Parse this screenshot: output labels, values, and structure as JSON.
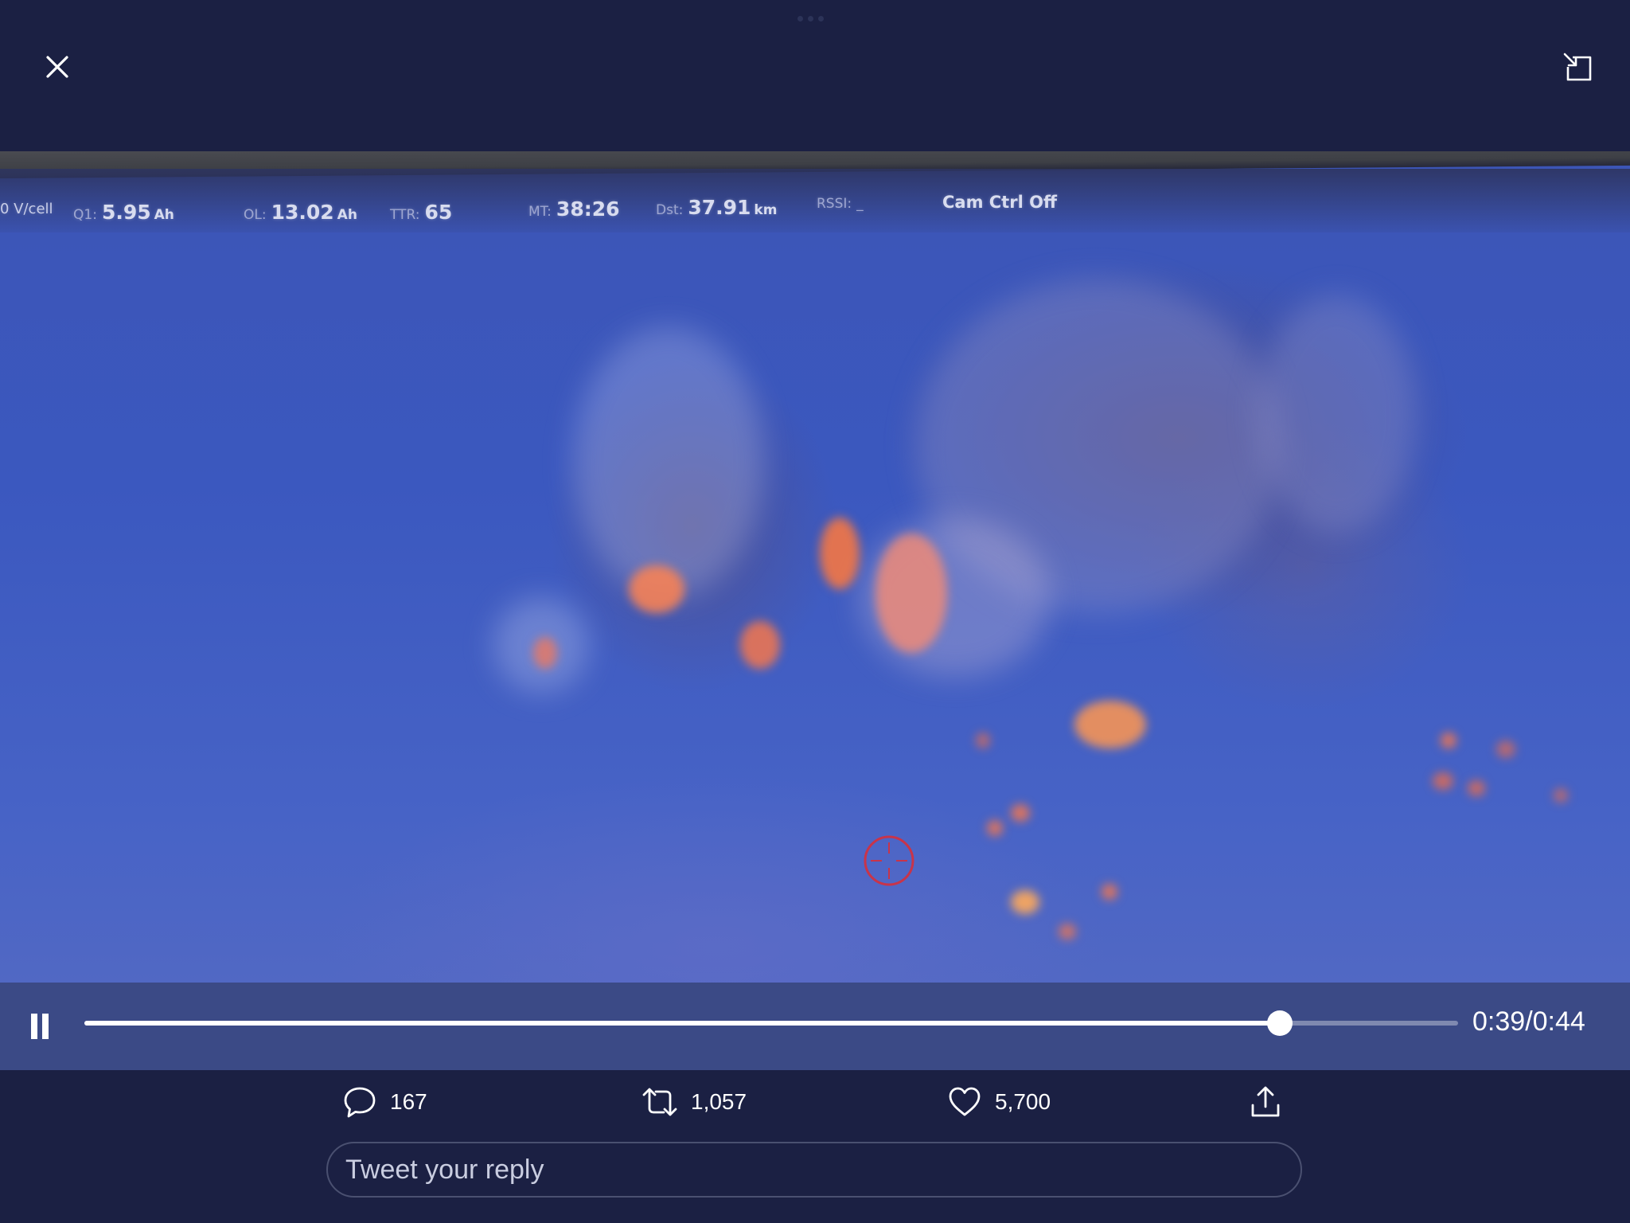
{
  "top_bar": {
    "close_icon": "close-icon",
    "minimize_icon": "picture-in-picture-icon"
  },
  "video": {
    "hud": {
      "cell_voltage": {
        "label": "",
        "value": "0 V/cell"
      },
      "q1": {
        "label": "Q1:",
        "value": "5.95",
        "unit": "Ah"
      },
      "ol": {
        "label": "OL:",
        "value": "13.02",
        "unit": "Ah"
      },
      "ttr": {
        "label": "TTR:",
        "value": "65"
      },
      "mt": {
        "label": "MT:",
        "value": "38:26"
      },
      "dst": {
        "label": "Dst:",
        "value": "37.91",
        "unit": "km"
      },
      "rssi": {
        "label": "RSSI:",
        "value": "_"
      },
      "cam": {
        "value": "Cam Ctrl Off"
      }
    },
    "crosshair_icon": "crosshair-icon"
  },
  "controls": {
    "pause_icon": "pause-icon",
    "progress_fraction": 0.87,
    "current_time": "0:39",
    "separator": "/",
    "duration": "0:44"
  },
  "actions": {
    "reply": {
      "icon": "comment-icon",
      "count": "167"
    },
    "retweet": {
      "icon": "retweet-icon",
      "count": "1,057"
    },
    "like": {
      "icon": "heart-icon",
      "count": "5,700"
    },
    "share": {
      "icon": "share-icon"
    }
  },
  "reply_box": {
    "placeholder": "Tweet your reply",
    "value": ""
  },
  "colors": {
    "background": "#1b2043",
    "accent_white": "#ffffff",
    "crosshair": "#c8344a",
    "fire": "#ff8a4a"
  }
}
